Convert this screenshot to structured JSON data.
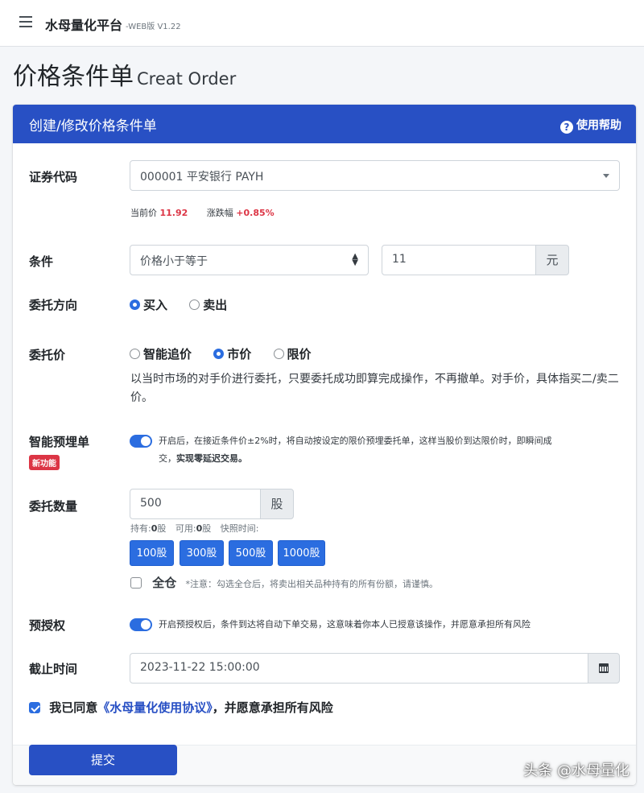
{
  "topbar": {
    "brand": "水母量化平台",
    "version": "-WEB版 V1.22"
  },
  "page": {
    "title": "价格条件单",
    "subtitle": "Creat Order"
  },
  "card": {
    "title": "创建/修改价格条件单",
    "help_label": "使用帮助"
  },
  "stock": {
    "label": "证券代码",
    "selected": "000001 平安银行 PAYH",
    "price_label": "当前价",
    "price": "11.92",
    "change_label": "涨跌幅",
    "change": "+0.85%"
  },
  "condition": {
    "label": "条件",
    "selected": "价格小于等于",
    "value": "11",
    "unit": "元"
  },
  "direction": {
    "label": "委托方向",
    "options": [
      "买入",
      "卖出"
    ],
    "selected": "买入"
  },
  "order_price": {
    "label": "委托价",
    "options": [
      "智能追价",
      "市价",
      "限价"
    ],
    "selected": "市价",
    "description": "以当时市场的对手价进行委托，只要委托成功即算完成操作，不再撤单。对手价，具体指买二/卖二价。"
  },
  "smart_preorder": {
    "label": "智能预埋单",
    "badge": "新功能",
    "enabled": true,
    "text_1": "开启后，在接近条件价±2%时，将自动按设定的限价预埋委托单，这样当股价到达限价时，即瞬间成",
    "text_2": "交，",
    "text_bold": "实现零延迟交易。"
  },
  "quantity": {
    "label": "委托数量",
    "value": "500",
    "unit": "股",
    "hold_label": "持有:",
    "hold": "0",
    "avail_label": "可用:",
    "avail": "0",
    "share": "股",
    "snapshot_label": "快照时间:",
    "quick": [
      "100股",
      "300股",
      "500股",
      "1000股"
    ],
    "full_label": "全仓",
    "full_note": "*注意：勾选全仓后，将卖出相关品种持有的所有份额，请谨慎。"
  },
  "pre_auth": {
    "label": "预授权",
    "enabled": true,
    "text": "开启预授权后，条件到达将自动下单交易，这意味着你本人已授意该操作，并愿意承担所有风险"
  },
  "deadline": {
    "label": "截止时间",
    "value": "2023-11-22 15:00:00"
  },
  "agreement": {
    "checked": true,
    "prefix": "我已同意",
    "link": "《水母量化使用协议》",
    "suffix": "，并愿意承担所有风险"
  },
  "submit_label": "提交",
  "watermark": "头条 @水母量化",
  "colors": {
    "primary": "#2850c4",
    "accent": "#2b6de0",
    "danger": "#dc3545"
  }
}
